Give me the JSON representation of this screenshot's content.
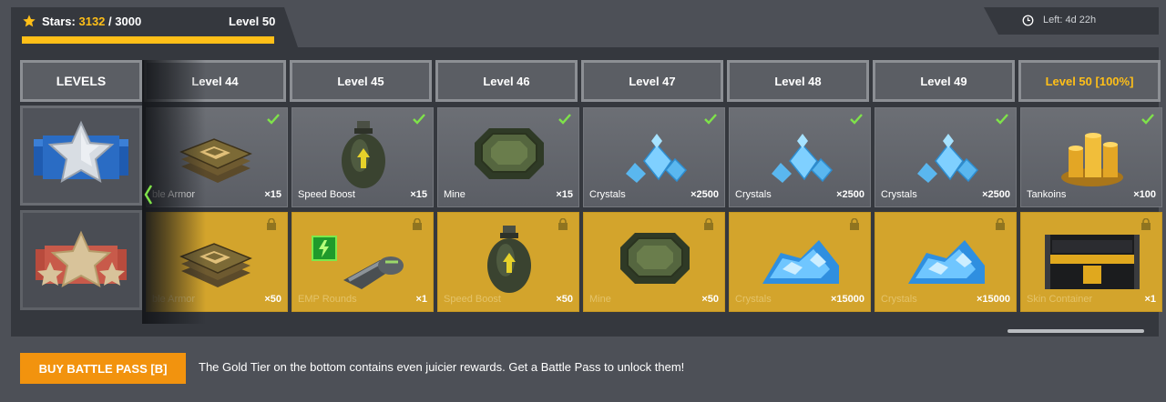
{
  "header": {
    "stars_label": "Stars:",
    "stars_current": "3132",
    "stars_total": "/ 3000",
    "level": "Level 50",
    "progress": 1.0,
    "timer": "Left: 4d 22h"
  },
  "colors": {
    "accent": "#ffbf18",
    "gold_tier": "#d3a42c",
    "button": "#f2930e",
    "check": "#7fe24a"
  },
  "levels_header": "LEVELS",
  "columns": [
    {
      "level": "Level 44",
      "highlight": false,
      "silver": {
        "name": "Composite Armor",
        "shown_name": "ble Armor",
        "count": "×15",
        "icon": "armor-plates-icon",
        "claimed": true
      },
      "gold": {
        "name": "Composite Armor",
        "shown_name": "ble Armor",
        "count": "×50",
        "icon": "armor-plates-icon"
      }
    },
    {
      "level": "Level 45",
      "highlight": false,
      "silver": {
        "shown_name": "Speed Boost",
        "count": "×15",
        "icon": "speed-boost-icon",
        "claimed": true
      },
      "gold": {
        "shown_name": "EMP Rounds",
        "count": "×1",
        "icon": "emp-rounds-icon"
      }
    },
    {
      "level": "Level 46",
      "highlight": false,
      "silver": {
        "shown_name": "Mine",
        "count": "×15",
        "icon": "mine-icon",
        "claimed": true
      },
      "gold": {
        "shown_name": "Speed Boost",
        "count": "×50",
        "icon": "speed-boost-icon"
      }
    },
    {
      "level": "Level 47",
      "highlight": false,
      "silver": {
        "shown_name": "Crystals",
        "count": "×2500",
        "icon": "crystals-icon",
        "claimed": true
      },
      "gold": {
        "shown_name": "Mine",
        "count": "×50",
        "icon": "mine-icon"
      }
    },
    {
      "level": "Level 48",
      "highlight": false,
      "silver": {
        "shown_name": "Crystals",
        "count": "×2500",
        "icon": "crystals-icon",
        "claimed": true
      },
      "gold": {
        "shown_name": "Crystals",
        "count": "×15000",
        "icon": "crystal-pile-icon"
      }
    },
    {
      "level": "Level 49",
      "highlight": false,
      "silver": {
        "shown_name": "Crystals",
        "count": "×2500",
        "icon": "crystals-icon",
        "claimed": true
      },
      "gold": {
        "shown_name": "Crystals",
        "count": "×15000",
        "icon": "crystal-pile-icon"
      }
    },
    {
      "level": "Level 50 [100%]",
      "highlight": true,
      "silver": {
        "shown_name": "Tankoins",
        "count": "×100",
        "icon": "tankoins-icon",
        "claimed": true
      },
      "gold": {
        "shown_name": "Skin Container",
        "count": "×1",
        "icon": "skin-container-icon"
      }
    }
  ],
  "footer": {
    "buy_button": "BUY BATTLE PASS [B]",
    "message": "The Gold Tier on the bottom contains even juicier rewards. Get a Battle Pass to unlock them!"
  }
}
